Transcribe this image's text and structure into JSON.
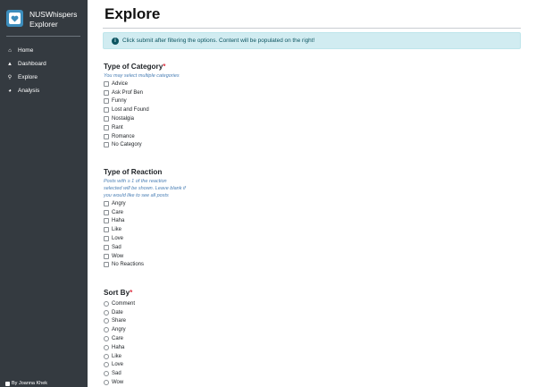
{
  "sidebar": {
    "brand_title": "NUSWhispers Explorer",
    "items": [
      {
        "label": "Home",
        "icon": "home-icon",
        "glyph": "⌂"
      },
      {
        "label": "Dashboard",
        "icon": "chart-area-icon",
        "glyph": "▲"
      },
      {
        "label": "Explore",
        "icon": "search-icon",
        "glyph": "⚲"
      },
      {
        "label": "Analysis",
        "icon": "pie-chart-icon",
        "glyph": "◕"
      }
    ],
    "footer": "By Joanna Khek"
  },
  "main": {
    "title": "Explore",
    "info_icon": "i",
    "info_text": "Click submit after filtering the options. Content will be populated on the right!",
    "category": {
      "title": "Type of Category",
      "required_mark": "*",
      "hint": "You may select multiple categories",
      "options": [
        "Advice",
        "Ask Prof Ben",
        "Funny",
        "Lost and Found",
        "Nostalgia",
        "Rant",
        "Romance",
        "No Category"
      ]
    },
    "reaction": {
      "title": "Type of Reaction",
      "hint": "Posts with ≥ 1 of the reaction selected will be shown. Leave blank if you would like to see all posts",
      "options": [
        "Angry",
        "Care",
        "Haha",
        "Like",
        "Love",
        "Sad",
        "Wow",
        "No Reactions"
      ]
    },
    "sort": {
      "title": "Sort By",
      "required_mark": "*",
      "options": [
        "Comment",
        "Date",
        "Share",
        "Angry",
        "Care",
        "Haha",
        "Like",
        "Love",
        "Sad",
        "Wow"
      ]
    }
  },
  "colors": {
    "sidebar_bg": "#343a40",
    "info_bg": "#d1ecf1",
    "info_text": "#0c5460",
    "required": "#dc3545",
    "hint": "#4a7fb5"
  }
}
